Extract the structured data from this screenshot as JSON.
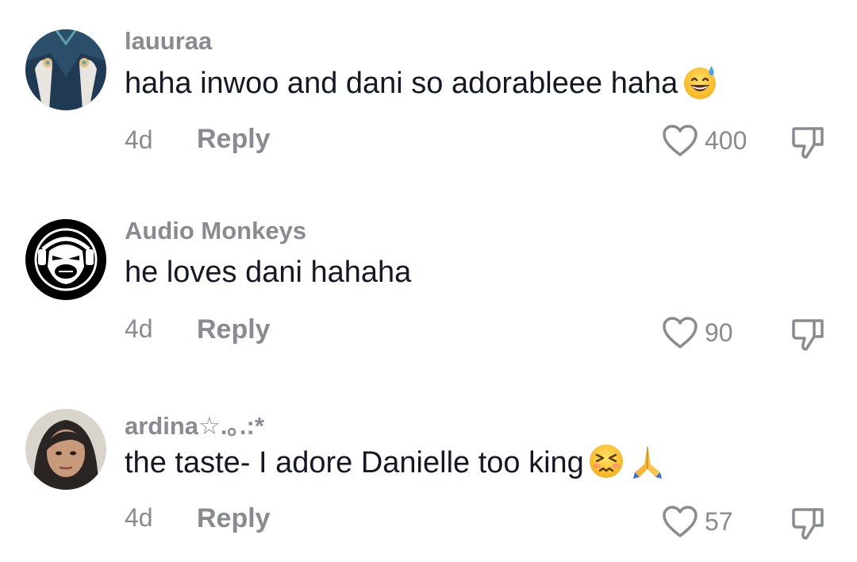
{
  "comments": [
    {
      "username": "lauuraa",
      "text": "haha inwoo and dani so adorableee haha",
      "emojis": [
        "grinning-sweat-emoji"
      ],
      "time": "4d",
      "reply_label": "Reply",
      "likes": "400"
    },
    {
      "username": "Audio Monkeys",
      "text": "he loves dani hahaha",
      "emojis": [],
      "time": "4d",
      "reply_label": "Reply",
      "likes": "90"
    },
    {
      "username": "ardina☆.｡.:*",
      "text": "the taste- I adore Danielle too king",
      "emojis": [
        "confounded-face-emoji",
        "folded-hands-emoji"
      ],
      "time": "4d",
      "reply_label": "Reply",
      "likes": "57"
    }
  ],
  "colors": {
    "text": "#161823",
    "muted": "#8a8b91",
    "background": "#ffffff"
  }
}
